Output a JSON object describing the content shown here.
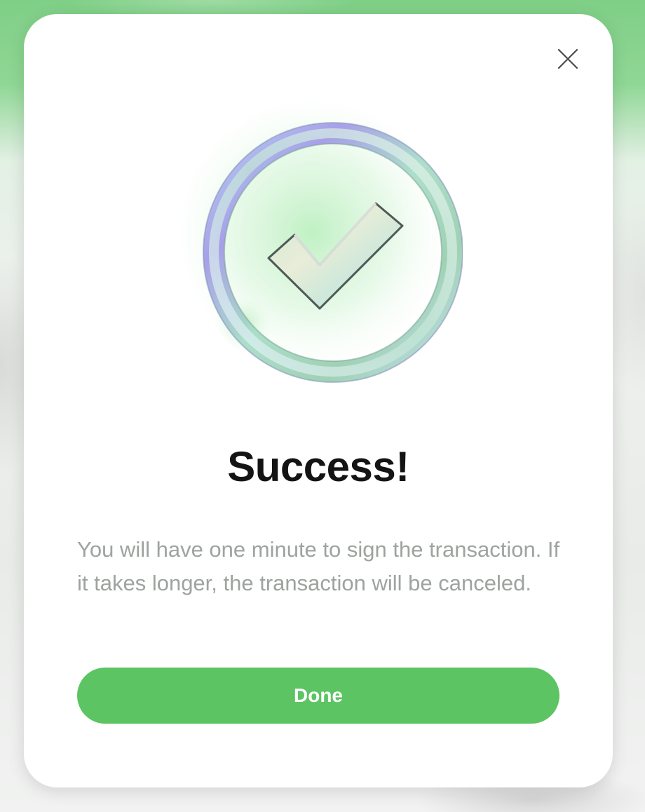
{
  "dialog": {
    "close_icon": "close-icon",
    "illustration_icon": "checkmark-circle-icon",
    "title": "Success!",
    "message": "You will have one minute to sign the transaction. If it takes longer, the transaction will be canceled.",
    "done_label": "Done"
  },
  "colors": {
    "accent": "#5cc463",
    "title": "#141414",
    "message": "#9ea39f",
    "backdrop_top": "#7fcf86"
  }
}
